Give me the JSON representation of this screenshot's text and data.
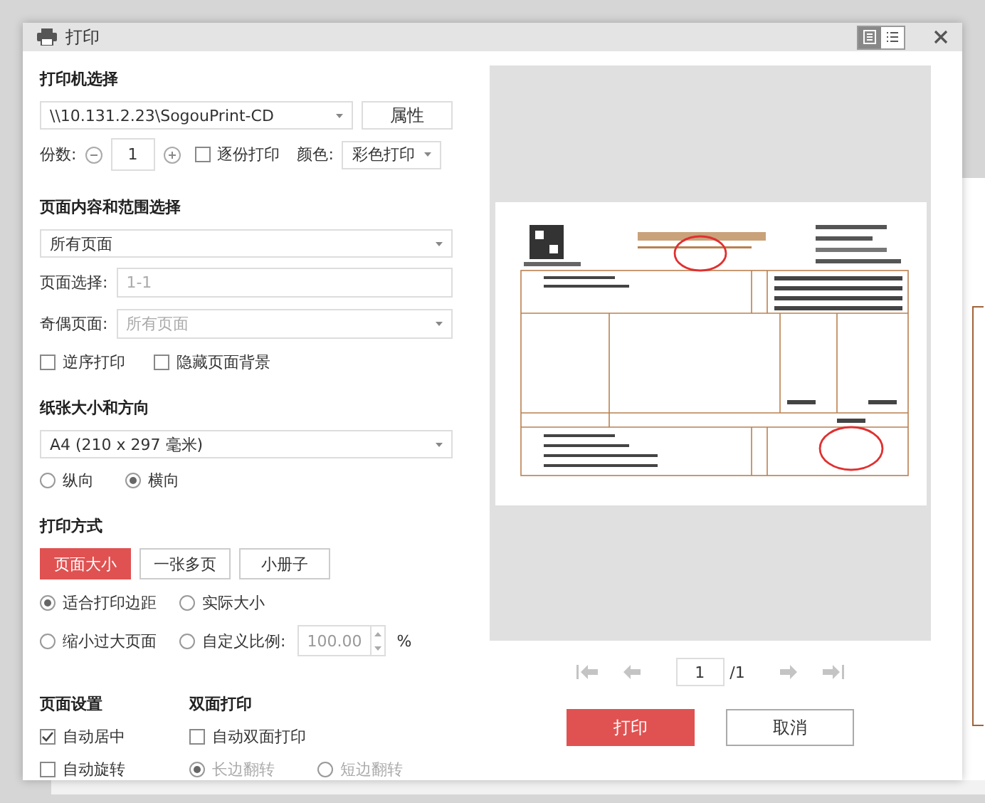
{
  "window": {
    "title": "打印",
    "view_modes": [
      {
        "selected": true
      },
      {
        "selected": false
      }
    ]
  },
  "printer": {
    "title": "打印机选择",
    "value": "\\\\10.131.2.23\\SogouPrint-CD",
    "properties_button": "属性"
  },
  "copies": {
    "label": "份数:",
    "value": "1",
    "collate": {
      "label": "逐份打印",
      "checked": false
    },
    "color_label": "颜色:",
    "color_value": "彩色打印"
  },
  "range": {
    "title": "页面内容和范围选择",
    "value": "所有页面",
    "page_select": {
      "label": "页面选择:",
      "value": "1-1",
      "disabled": true
    },
    "odd_even": {
      "label": "奇偶页面:",
      "value": "所有页面",
      "disabled": true
    },
    "options": [
      {
        "label": "逆序打印",
        "checked": false
      },
      {
        "label": "隐藏页面背景",
        "checked": false
      }
    ]
  },
  "paper": {
    "title": "纸张大小和方向",
    "value": "A4 (210 x 297 毫米)",
    "orientation": [
      {
        "label": "纵向",
        "selected": false
      },
      {
        "label": "横向",
        "selected": true
      }
    ]
  },
  "print_mode": {
    "title": "打印方式",
    "tabs": [
      {
        "label": "页面大小",
        "selected": true
      },
      {
        "label": "一张多页",
        "selected": false
      },
      {
        "label": "小册子",
        "selected": false
      }
    ],
    "scaling": [
      {
        "label": "适合打印边距",
        "selected": true
      },
      {
        "label": "实际大小",
        "selected": false
      },
      {
        "label": "缩小过大页面",
        "selected": false
      },
      {
        "label": "自定义比例:",
        "selected": false
      }
    ],
    "custom_scale": "100.00",
    "unit": "%"
  },
  "page_setup": {
    "title": "页面设置",
    "options": [
      {
        "label": "自动居中",
        "checked": true
      },
      {
        "label": "自动旋转",
        "checked": false
      }
    ]
  },
  "duplex": {
    "title": "双面打印",
    "auto": {
      "label": "自动双面打印",
      "checked": false
    },
    "disabled": true,
    "flip": [
      {
        "label": "长边翻转",
        "selected": true
      },
      {
        "label": "短边翻转",
        "selected": false
      }
    ]
  },
  "pager": {
    "page": "1",
    "total": "/1"
  },
  "buttons": [
    {
      "label": "打印",
      "kind": "primary"
    },
    {
      "label": "取消",
      "kind": "secondary"
    }
  ]
}
